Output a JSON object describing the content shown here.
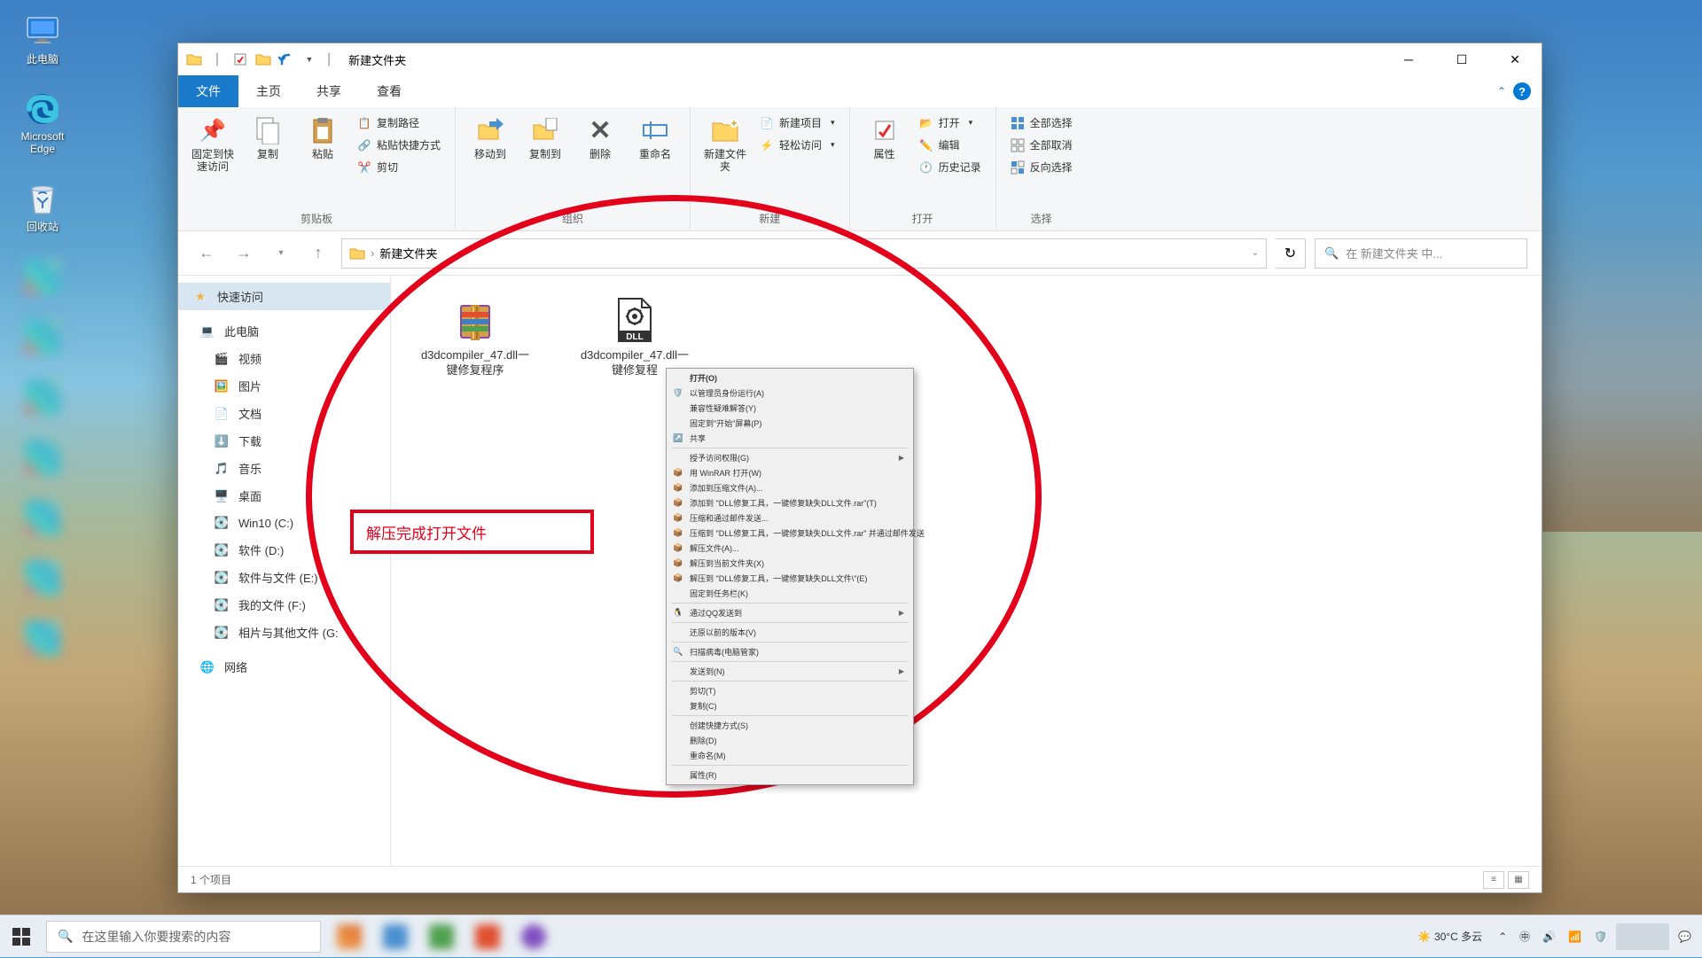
{
  "desktop": {
    "icons": [
      {
        "label": "此电脑",
        "name": "desktop-icon-thispc"
      },
      {
        "label": "Microsoft Edge",
        "name": "desktop-icon-edge"
      },
      {
        "label": "回收站",
        "name": "desktop-icon-recyclebin"
      }
    ],
    "blurred_count": 7
  },
  "explorer": {
    "title": "新建文件夹",
    "tabs": {
      "file": "文件",
      "home": "主页",
      "share": "共享",
      "view": "查看"
    },
    "ribbon": {
      "clipboard": {
        "pin": "固定到快速访问",
        "copy": "复制",
        "paste": "粘贴",
        "copypath": "复制路径",
        "pasteshortcut": "粘贴快捷方式",
        "cut": "剪切",
        "label": "剪贴板"
      },
      "organize": {
        "moveto": "移动到",
        "copyto": "复制到",
        "delete": "删除",
        "rename": "重命名",
        "label": "组织"
      },
      "new": {
        "newfolder": "新建文件夹",
        "newitem": "新建项目",
        "easyaccess": "轻松访问",
        "label": "新建"
      },
      "open": {
        "properties": "属性",
        "open": "打开",
        "edit": "编辑",
        "history": "历史记录",
        "label": "打开"
      },
      "select": {
        "selectall": "全部选择",
        "selectnone": "全部取消",
        "invert": "反向选择",
        "label": "选择"
      }
    },
    "address": "新建文件夹",
    "search_placeholder": "在 新建文件夹 中...",
    "sidebar": {
      "quickaccess": "快速访问",
      "thispc": "此电脑",
      "items": [
        {
          "label": "视频",
          "icon": "video-icon"
        },
        {
          "label": "图片",
          "icon": "pictures-icon"
        },
        {
          "label": "文档",
          "icon": "documents-icon"
        },
        {
          "label": "下载",
          "icon": "downloads-icon"
        },
        {
          "label": "音乐",
          "icon": "music-icon"
        },
        {
          "label": "桌面",
          "icon": "desktop-folder-icon"
        },
        {
          "label": "Win10 (C:)",
          "icon": "drive-icon"
        },
        {
          "label": "软件 (D:)",
          "icon": "drive-icon"
        },
        {
          "label": "软件与文件 (E:)",
          "icon": "drive-icon"
        },
        {
          "label": "我的文件 (F:)",
          "icon": "drive-icon"
        },
        {
          "label": "相片与其他文件 (G:",
          "icon": "drive-icon"
        }
      ],
      "network": "网络"
    },
    "files": [
      {
        "name": "d3dcompiler_47.dll一键修复程序",
        "type": "rar"
      },
      {
        "name": "d3dcompiler_47.dll一键修复程",
        "type": "exe-dll"
      }
    ],
    "status": "1 个项目"
  },
  "context_menu": [
    {
      "label": "打开(O)",
      "icon": "",
      "bold": true
    },
    {
      "label": "以管理员身份运行(A)",
      "icon": "shield"
    },
    {
      "label": "兼容性疑难解答(Y)",
      "icon": ""
    },
    {
      "label": "固定到\"开始\"屏幕(P)",
      "icon": ""
    },
    {
      "label": "共享",
      "icon": "share"
    },
    {
      "sep": true
    },
    {
      "label": "授予访问权限(G)",
      "icon": "",
      "sub": true
    },
    {
      "label": "用 WinRAR 打开(W)",
      "icon": "rar"
    },
    {
      "label": "添加到压缩文件(A)...",
      "icon": "rar"
    },
    {
      "label": "添加到 \"DLL修复工具，一键修复缺失DLL文件.rar\"(T)",
      "icon": "rar"
    },
    {
      "label": "压缩和通过邮件发送...",
      "icon": "rar"
    },
    {
      "label": "压缩到 \"DLL修复工具，一键修复缺失DLL文件.rar\" 并通过邮件发送",
      "icon": "rar"
    },
    {
      "label": "解压文件(A)...",
      "icon": "rar"
    },
    {
      "label": "解压到当前文件夹(X)",
      "icon": "rar"
    },
    {
      "label": "解压到 \"DLL修复工具，一键修复缺失DLL文件\\\"(E)",
      "icon": "rar"
    },
    {
      "label": "固定到任务栏(K)",
      "icon": ""
    },
    {
      "sep": true
    },
    {
      "label": "通过QQ发送到",
      "icon": "qq",
      "sub": true
    },
    {
      "sep": true
    },
    {
      "label": "还原以前的版本(V)",
      "icon": ""
    },
    {
      "sep": true
    },
    {
      "label": "扫描病毒(电脑管家)",
      "icon": "scan"
    },
    {
      "sep": true
    },
    {
      "label": "发送到(N)",
      "icon": "",
      "sub": true
    },
    {
      "sep": true
    },
    {
      "label": "剪切(T)",
      "icon": ""
    },
    {
      "label": "复制(C)",
      "icon": ""
    },
    {
      "sep": true
    },
    {
      "label": "创建快捷方式(S)",
      "icon": ""
    },
    {
      "label": "删除(D)",
      "icon": ""
    },
    {
      "label": "重命名(M)",
      "icon": ""
    },
    {
      "sep": true
    },
    {
      "label": "属性(R)",
      "icon": ""
    }
  ],
  "annotation": {
    "box_text": "解压完成打开文件"
  },
  "taskbar": {
    "search_placeholder": "在这里输入你要搜索的内容",
    "weather": "30°C 多云"
  }
}
